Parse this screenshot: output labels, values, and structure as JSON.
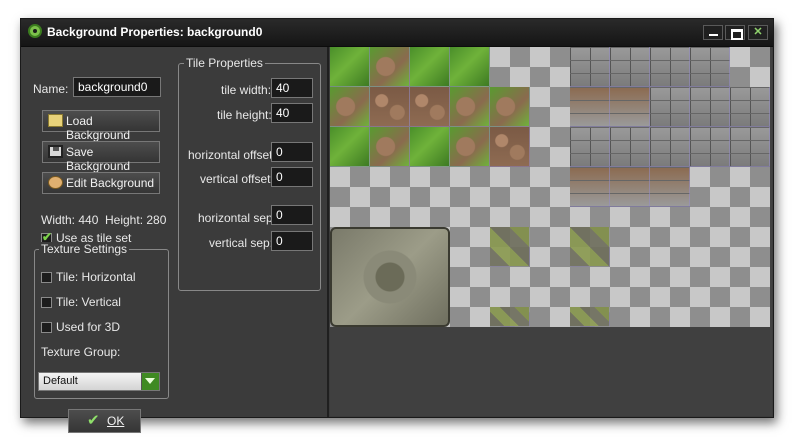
{
  "window": {
    "title": "Background Properties: background0",
    "close_glyph": "✕"
  },
  "form": {
    "name_label": "Name:",
    "name_value": "background0",
    "load_button": "Load Background",
    "save_button": "Save Background",
    "edit_button": "Edit Background",
    "width_text": "Width: 440",
    "height_text": "Height: 280",
    "use_tile_set": {
      "label": "Use as tile set",
      "checked": true
    }
  },
  "texture_settings": {
    "title": "Texture Settings",
    "tile_horizontal": {
      "label": "Tile: Horizontal",
      "checked": false
    },
    "tile_vertical": {
      "label": "Tile: Vertical",
      "checked": false
    },
    "used_3d": {
      "label": "Used for 3D",
      "checked": false
    },
    "group_label": "Texture Group:",
    "group_value": "Default"
  },
  "tile_properties": {
    "title": "Tile Properties",
    "tile_width_label": "tile width:",
    "tile_width": "40",
    "tile_height_label": "tile height:",
    "tile_height": "40",
    "h_offset_label": "horizontal offset:",
    "h_offset": "0",
    "v_offset_label": "vertical offset:",
    "v_offset": "0",
    "h_sep_label": "horizontal sep:",
    "h_sep": "0",
    "v_sep_label": "vertical sep:",
    "v_sep": "0"
  },
  "ok_button": {
    "label": "OK"
  },
  "colors": {
    "accent": "#3f8a22",
    "background": "#3b3b3b",
    "titlebar": "#151515"
  },
  "icons": [
    "app-icon",
    "folder-open-icon",
    "floppy-disk-icon",
    "palette-icon",
    "checkmark-icon",
    "chevron-down-icon"
  ]
}
